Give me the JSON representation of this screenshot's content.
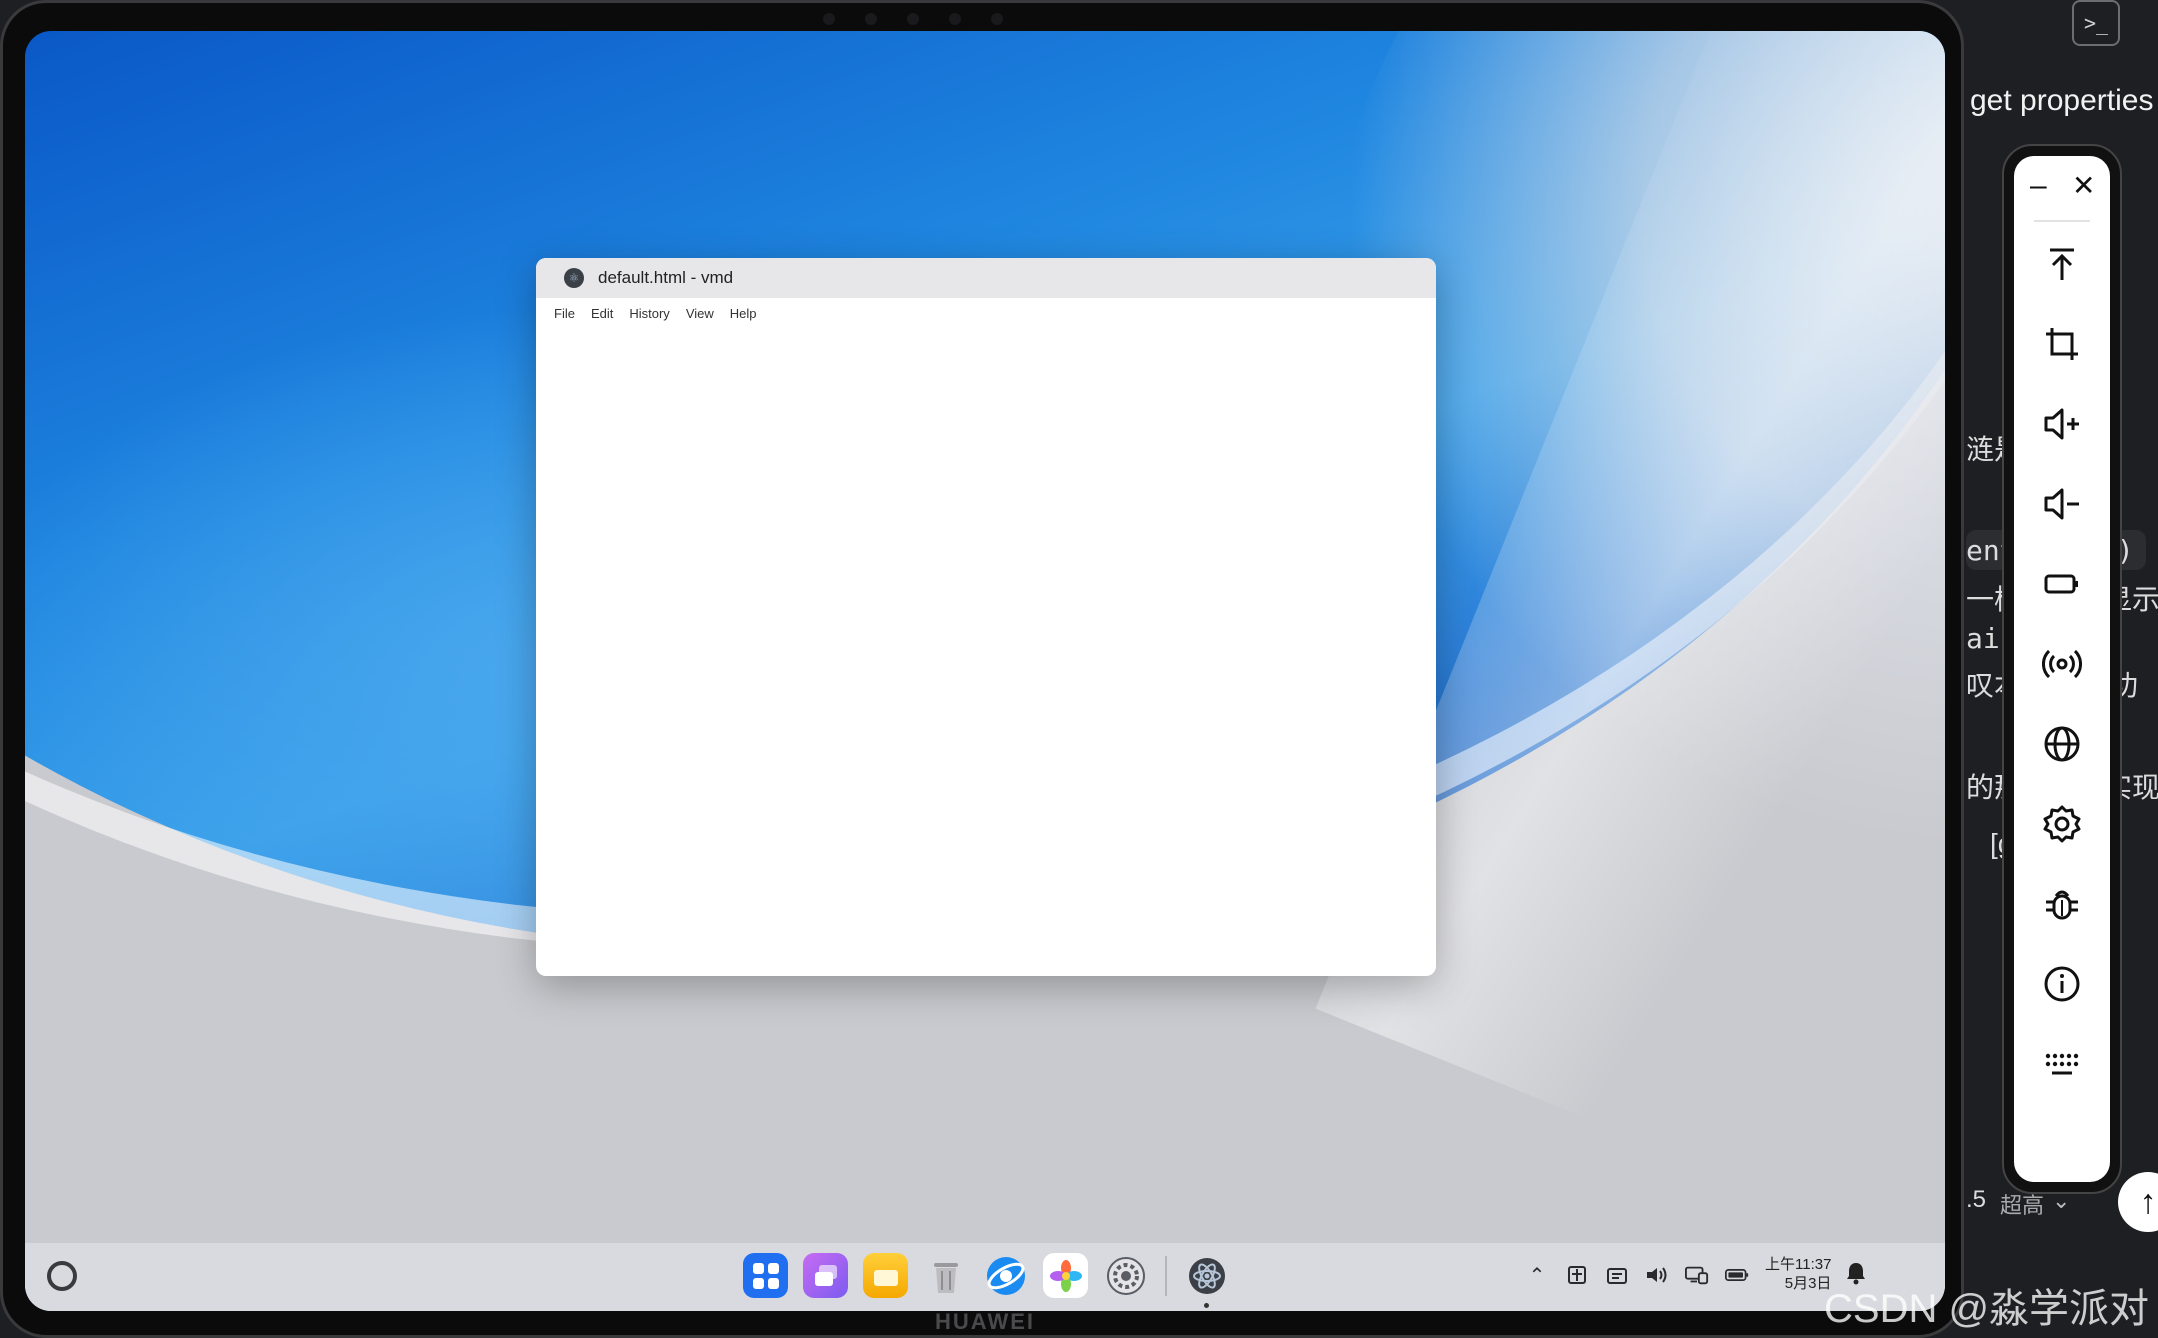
{
  "window": {
    "title": "default.html - vmd",
    "menu": [
      "File",
      "Edit",
      "History",
      "View",
      "Help"
    ]
  },
  "device": {
    "brand": "HUAWEI"
  },
  "taskbar": {
    "dock": [
      {
        "name": "app-center",
        "color": "#1f6ff0"
      },
      {
        "name": "multi-window",
        "color": "#9a5be8"
      },
      {
        "name": "files",
        "color": "#f5b800"
      },
      {
        "name": "trash",
        "color": "#c9c9cc"
      },
      {
        "name": "browser",
        "color": "#1a8bf0"
      },
      {
        "name": "gallery",
        "color": "#ffffff"
      },
      {
        "name": "settings",
        "color": "#5a5d63"
      },
      {
        "name": "vmd-app",
        "color": "#3b3f46"
      }
    ],
    "clock": {
      "time": "上午11:37",
      "date": "5月3日"
    }
  },
  "host": {
    "header": "get properties",
    "fragments": [
      "涟是",
      "ent",
      "f)",
      "一样",
      "显示",
      "ain\"",
      "叹本",
      "功",
      "的那",
      "实现",
      "[g"
    ],
    "footer_value": ".5",
    "footer_label": "超高",
    "terminal_icon": ">_"
  },
  "control_panel": {
    "items": [
      "move-to-top-icon",
      "crop-icon",
      "volume-up-icon",
      "volume-down-icon",
      "battery-icon",
      "broadcast-icon",
      "globe-icon",
      "gear-icon",
      "bug-icon",
      "info-icon",
      "keyboard-icon"
    ]
  },
  "watermark": "CSDN @淼学派对"
}
